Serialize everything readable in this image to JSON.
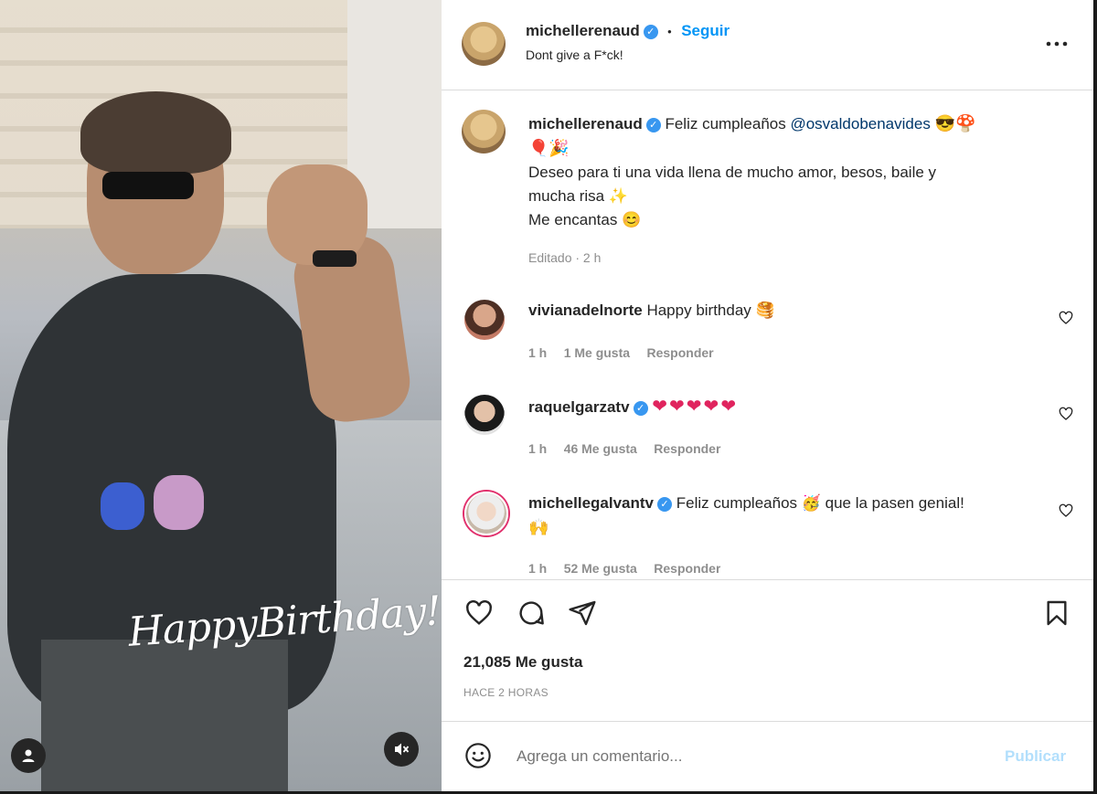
{
  "media": {
    "overlay_text": "HappyBirthday!",
    "user_tag_icon": "user-icon",
    "mute_icon": "speaker-muted-icon"
  },
  "header": {
    "username": "michellerenaud",
    "dot": "•",
    "follow_label": "Seguir",
    "subtitle": "Dont give a F*ck!",
    "more_icon": "more-horizontal-icon"
  },
  "caption": {
    "username": "michellerenaud",
    "text_prefix": "Feliz cumpleaños",
    "mention": "@osvaldobenavides",
    "emojis_line1": "😎🍄",
    "emojis_line2": "🎈🎉",
    "line3": "Deseo para ti una vida llena de mucho amor, besos, baile y",
    "line4": "mucha risa ✨",
    "line5": "Me encantas 😊",
    "meta": "Editado · 2 h"
  },
  "comments": [
    {
      "username": "vivianadelnorte",
      "text": "Happy birthday 🥞",
      "time": "1 h",
      "likes": "1 Me gusta",
      "reply": "Responder",
      "verified": false
    },
    {
      "username": "raquelgarzatv",
      "text": "❤❤❤❤❤",
      "time": "1 h",
      "likes": "46 Me gusta",
      "reply": "Responder",
      "verified": true
    },
    {
      "username": "michellegalvantv",
      "text": "Feliz cumpleaños 🥳 que la pasen genial!",
      "text2": "🙌",
      "time": "1 h",
      "likes": "52 Me gusta",
      "reply": "Responder",
      "verified": true
    }
  ],
  "actions": {
    "like_icon": "heart-icon",
    "comment_icon": "comment-icon",
    "share_icon": "send-icon",
    "save_icon": "bookmark-icon"
  },
  "stats": {
    "likes": "21,085 Me gusta",
    "time": "HACE 2 HORAS"
  },
  "comment_box": {
    "emoji_icon": "smiley-icon",
    "placeholder": "Agrega un comentario...",
    "publish_label": "Publicar"
  },
  "colors": {
    "link": "#0095f6",
    "verified": "#3897f0",
    "publish_disabled": "#b2dffc",
    "text": "#262626",
    "muted": "#8e8e8e"
  }
}
